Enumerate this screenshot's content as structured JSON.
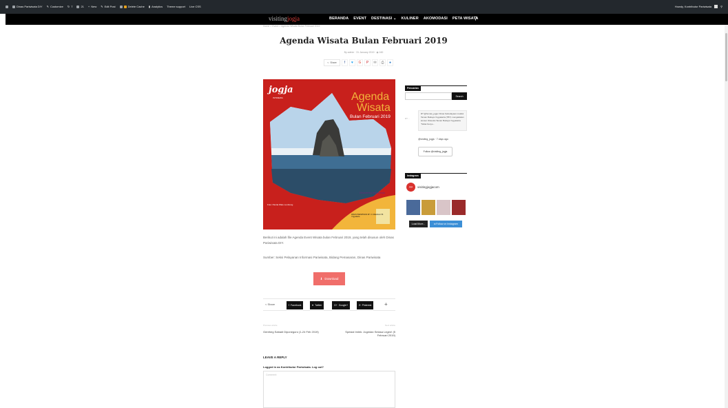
{
  "adminbar": {
    "site": "Dinas Pariwisata DIY",
    "customize": "Customize",
    "updates": "7",
    "comments": "21",
    "new": "New",
    "edit_post": "Edit Post",
    "delete_cache": "Delete Cache",
    "analytics": "Analytics",
    "theme_support": "Theme support",
    "live_css": "Live CSS",
    "howdy": "Howdy, Kontributor Pariwisata"
  },
  "nav": {
    "logo_main": "visiting",
    "logo_accent": "jogja",
    "items": [
      "BERANDA",
      "EVENT",
      "DESTINASI ⌄",
      "KULINER",
      "AKOMODASI",
      "PETA WISATA"
    ],
    "search_icon": "search-icon"
  },
  "breadcrumb": "Home  >  Event  >  Agenda Wisata Bulan Februari 2019",
  "post": {
    "title": "Agenda Wisata Bulan Februari 2019",
    "meta": "By admin  ·  31 January 2019  ·  ◉ 160",
    "share_label": "Share",
    "poster": {
      "logo": "jogja",
      "logo_sub": "ISTIMEWA",
      "agenda": "Agenda",
      "wisata": "Wisata",
      "bulan": "Bulan Februari 2019",
      "foto": "Foto: Pantai Watu Lumbung",
      "wi": "Wonderful Indonesia",
      "dinas": "DINAS PARIWISATA DIY Jl. Malioboro 56 Yogyakarta"
    },
    "paragraph1": "Berikut ini adalah file Agenda Event Wisata bulan Februari 2019, yang telah disusun oleh Dinas Pariwisata DIY.",
    "paragraph2": "Sumber: Seksi Pelayanan Informasi Pariwisata, Bidang Pemasaran, Dinas Pariwisata",
    "download": "Download",
    "sharebar": {
      "label": "Share",
      "facebook": "Facebook",
      "twitter": "Twitter",
      "google": "Google+",
      "pinterest": "Pinterest"
    },
    "prev_label": "Previous article",
    "prev_title": "Gerebeg Sabadi Diponegoro (1-24 Feb 2019)",
    "next_label": "Next article",
    "next_title": "Spesial Imlek: Jogedan Selasa Legen! (5 Februari 2019)"
  },
  "reply": {
    "heading": "LEAVE A REPLY",
    "logged_in": "Logged in as Kontributor Pariwisata.  Log out?",
    "comment_placeholder": "Comment:"
  },
  "sidebar": {
    "search_title": "Pencarian",
    "search_button": "Search",
    "tweet_side": "RT ...",
    "tweet_text": "RT @humas_jogja: Dinas Kebudayaan melalui Taman Budaya Yogyakarta (TBY) mengadakan konser Orkestra Taman Budaya Yogyakarta \"Mulai Kenyo...",
    "tweet_meta": "@visiting_jogja · 7 days ago",
    "follow_twitter": "Follow @visiting_jogja",
    "instagram_title": "Instagram",
    "ig_avatar": "jogja",
    "ig_name": "visitingjogjacom",
    "load_more": "Load More...",
    "follow_instagram": "Follow on Instagram"
  },
  "colors": {
    "adminbar": "#23282d",
    "nav": "#000000",
    "accent": "#e0403c",
    "download": "#f06e6a",
    "poster_red": "#c8201c",
    "poster_gold": "#f2b53b",
    "instagram_follow": "#3c8fd6"
  }
}
